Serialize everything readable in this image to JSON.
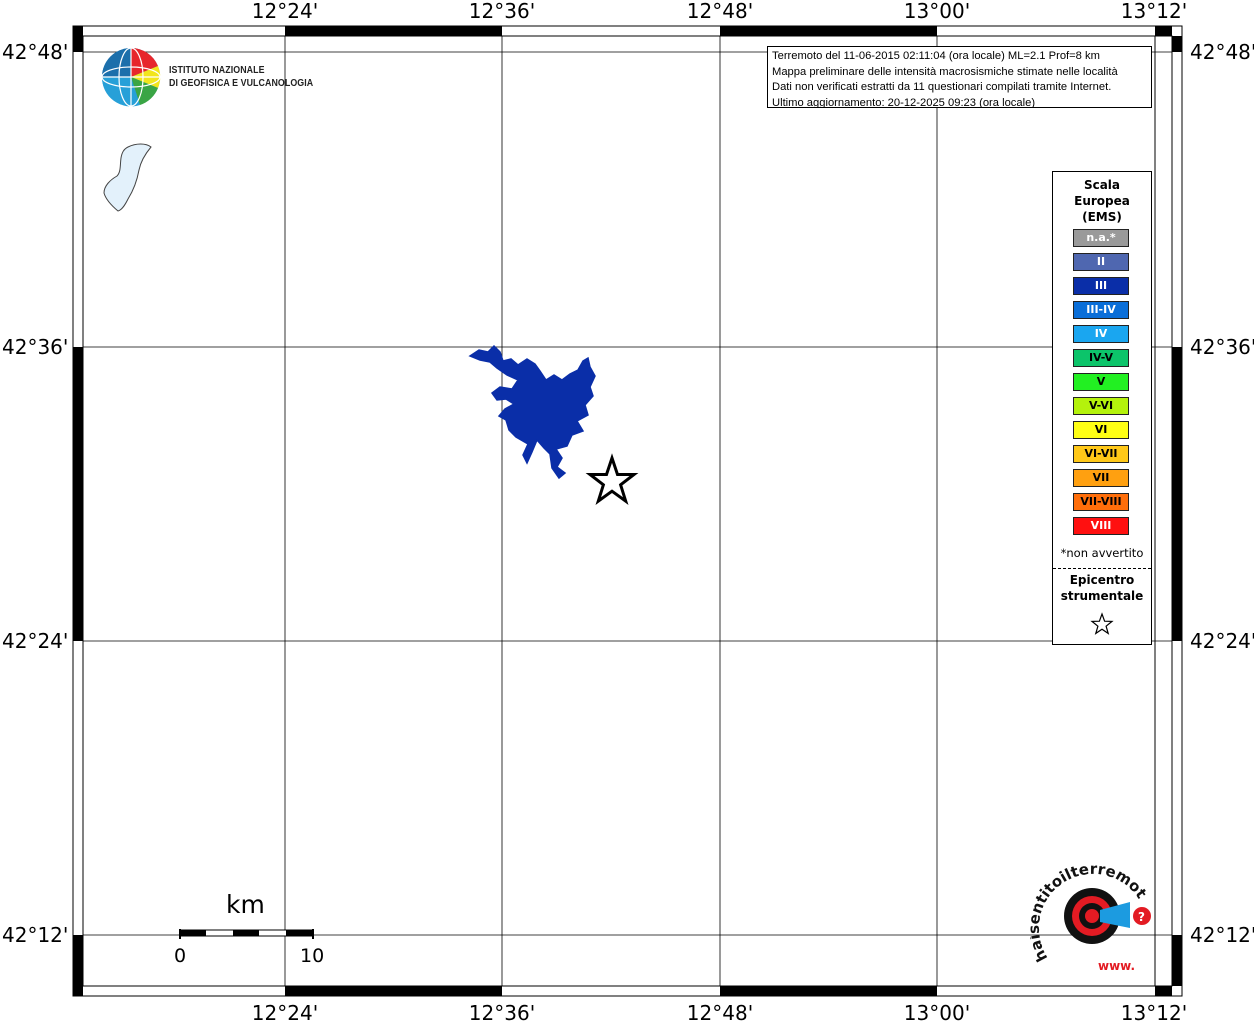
{
  "map": {
    "longitude_ticks": [
      "12°24'",
      "12°36'",
      "12°48'",
      "13°00'",
      "13°12'"
    ],
    "latitude_ticks": [
      "42°48'",
      "42°36'",
      "42°24'",
      "42°12'"
    ]
  },
  "info_box": {
    "line1": "Terremoto del 11-06-2015 02:11:04 (ora locale) ML=2.1 Prof=8 km",
    "line2": "Mappa preliminare delle intensità macrosismiche stimate nelle località",
    "line3": "Dati non verificati estratti da 11 questionari compilati tramite Internet.",
    "line4": "Ultimo aggiornamento: 20-12-2025 09:23 (ora locale)"
  },
  "logo": {
    "line1": "ISTITUTO NAZIONALE",
    "line2": "DI GEOFISICA E VULCANOLOGIA"
  },
  "legend": {
    "title_line1": "Scala",
    "title_line2": "Europea",
    "title_line3": "(EMS)",
    "items": [
      {
        "label": "n.a.*",
        "color": "#9a9a9a",
        "text_color": "#ffffff"
      },
      {
        "label": "II",
        "color": "#4f67b0",
        "text_color": "#ffffff"
      },
      {
        "label": "III",
        "color": "#0a2ea8",
        "text_color": "#ffffff"
      },
      {
        "label": "III-IV",
        "color": "#0a6ed8",
        "text_color": "#ffffff"
      },
      {
        "label": "IV",
        "color": "#1aa6f0",
        "text_color": "#ffffff"
      },
      {
        "label": "IV-V",
        "color": "#0cc46a",
        "text_color": "#000000"
      },
      {
        "label": "V",
        "color": "#22f022",
        "text_color": "#000000"
      },
      {
        "label": "V-VI",
        "color": "#b4f20c",
        "text_color": "#000000"
      },
      {
        "label": "VI",
        "color": "#ffff14",
        "text_color": "#000000"
      },
      {
        "label": "VI-VII",
        "color": "#ffc818",
        "text_color": "#000000"
      },
      {
        "label": "VII",
        "color": "#ffa010",
        "text_color": "#000000"
      },
      {
        "label": "VII-VIII",
        "color": "#ff6e0a",
        "text_color": "#000000"
      },
      {
        "label": "VIII",
        "color": "#ff1010",
        "text_color": "#ffffff"
      }
    ],
    "note": "*non avvertito",
    "epicenter_line1": "Epicentro",
    "epicenter_line2": "strumentale"
  },
  "scale_bar": {
    "unit": "km",
    "start_label": "0",
    "end_label": "10"
  },
  "watermark": {
    "text": "haisentitoilterremoto.it",
    "url": "www."
  },
  "colors": {
    "lake_main": "#0a2ea8",
    "lake_small": "#e3f1fb",
    "frame": "#000000"
  }
}
